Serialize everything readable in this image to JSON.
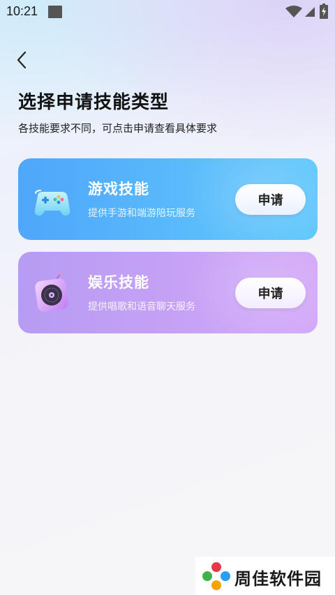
{
  "status_bar": {
    "time": "10:21"
  },
  "header": {
    "title": "选择申请技能类型",
    "subtitle": "各技能要求不同，可点击申请查看具体要求"
  },
  "cards": [
    {
      "title": "游戏技能",
      "description": "提供手游和端游陪玩服务",
      "button_label": "申请",
      "icon": "gamepad-icon",
      "color": "#4fa6fb"
    },
    {
      "title": "娱乐技能",
      "description": "提供唱歌和语音聊天服务",
      "button_label": "申请",
      "icon": "music-disc-icon",
      "color": "#c8a2f6"
    }
  ],
  "watermark": {
    "text": "周佳软件园"
  }
}
